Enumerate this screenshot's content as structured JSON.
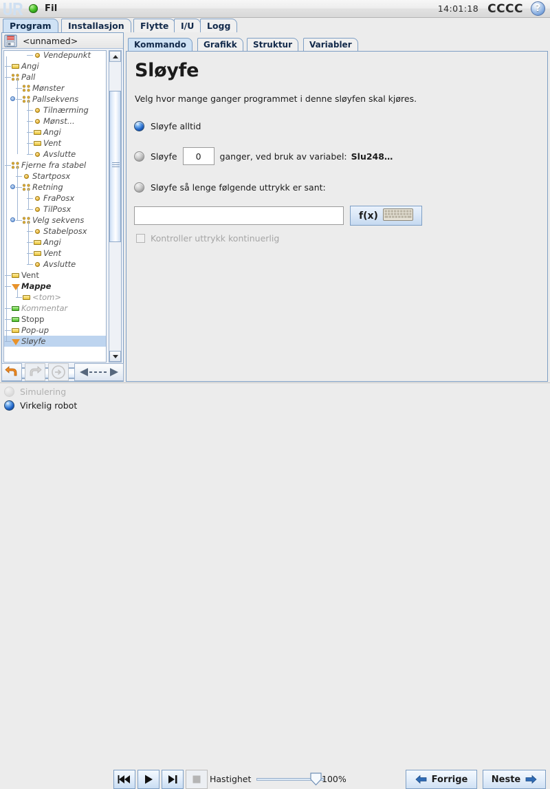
{
  "titlebar": {
    "file_menu_label": "Fil",
    "clock": "14:01:18",
    "robot_name": "CCCC",
    "help_label": "?"
  },
  "main_tabs": [
    {
      "label": "Program",
      "active": true
    },
    {
      "label": "Installasjon",
      "active": false
    },
    {
      "label": "Flytte",
      "active": false
    },
    {
      "label": "I/U",
      "active": false
    },
    {
      "label": "Logg",
      "active": false
    }
  ],
  "program_panel": {
    "program_name": "<unnamed>",
    "tree": [
      {
        "label": "Vendepunkt",
        "depth": 3,
        "icon": "dot",
        "style": "italic"
      },
      {
        "label": "Angi",
        "depth": 1,
        "icon": "rect",
        "style": "italic"
      },
      {
        "label": "Pall",
        "depth": 1,
        "icon": "pallet",
        "style": "italic",
        "knob": true
      },
      {
        "label": "Mønster",
        "depth": 2,
        "icon": "pallet",
        "style": "italic"
      },
      {
        "label": "Pallsekvens",
        "depth": 2,
        "icon": "pallet",
        "style": "italic",
        "knob": true
      },
      {
        "label": "Tilnærming",
        "depth": 3,
        "icon": "dot",
        "style": "italic"
      },
      {
        "label": "Mønst...",
        "depth": 3,
        "icon": "dot",
        "style": "italic"
      },
      {
        "label": "Angi",
        "depth": 3,
        "icon": "rect",
        "style": "italic"
      },
      {
        "label": "Vent",
        "depth": 3,
        "icon": "rect",
        "style": "italic"
      },
      {
        "label": "Avslutte",
        "depth": 3,
        "icon": "dot",
        "style": "italic"
      },
      {
        "label": "Fjerne fra stabel",
        "depth": 1,
        "icon": "pallet",
        "style": "italic",
        "knob": true
      },
      {
        "label": "Startposx",
        "depth": 2,
        "icon": "dot",
        "style": "italic"
      },
      {
        "label": "Retning",
        "depth": 2,
        "icon": "pallet",
        "style": "italic",
        "knob": true
      },
      {
        "label": "FraPosx",
        "depth": 3,
        "icon": "dot",
        "style": "italic"
      },
      {
        "label": "TilPosx",
        "depth": 3,
        "icon": "dot",
        "style": "italic"
      },
      {
        "label": "Velg sekvens",
        "depth": 2,
        "icon": "pallet",
        "style": "italic",
        "knob": true
      },
      {
        "label": "Stabelposx",
        "depth": 3,
        "icon": "dot",
        "style": "italic"
      },
      {
        "label": "Angi",
        "depth": 3,
        "icon": "rect",
        "style": "italic"
      },
      {
        "label": "Vent",
        "depth": 3,
        "icon": "rect",
        "style": "italic"
      },
      {
        "label": "Avslutte",
        "depth": 3,
        "icon": "dot",
        "style": "italic"
      },
      {
        "label": "Vent",
        "depth": 1,
        "icon": "rect",
        "style": "normal"
      },
      {
        "label": "Mappe",
        "depth": 1,
        "icon": "triangle",
        "style": "bold",
        "knob": true
      },
      {
        "label": "<tom>",
        "depth": 2,
        "icon": "rect",
        "style": "grey"
      },
      {
        "label": "Kommentar",
        "depth": 1,
        "icon": "rect-green",
        "style": "grey"
      },
      {
        "label": "Stopp",
        "depth": 1,
        "icon": "rect-green",
        "style": "normal"
      },
      {
        "label": "Pop-up",
        "depth": 1,
        "icon": "rect",
        "style": "italic"
      },
      {
        "label": "Sløyfe",
        "depth": 1,
        "icon": "triangle",
        "style": "italic",
        "knob": true,
        "selected": true
      }
    ],
    "toolbar": {
      "undo": "undo-arrow",
      "redo": "redo-arrow",
      "goto": "goto-arrow",
      "move": "move-handle"
    }
  },
  "sub_tabs": [
    {
      "label": "Kommando",
      "active": true
    },
    {
      "label": "Grafikk",
      "active": false
    },
    {
      "label": "Struktur",
      "active": false
    },
    {
      "label": "Variabler",
      "active": false
    }
  ],
  "command_panel": {
    "title": "Sløyfe",
    "description": "Velg hvor mange ganger programmet i denne sløyfen skal kjøres.",
    "options": [
      {
        "label": "Sløyfe alltid",
        "selected": true
      },
      {
        "label": "Sløyfe",
        "selected": false
      },
      {
        "label": "Sløyfe så lenge følgende uttrykk er sant:",
        "selected": false
      }
    ],
    "loop_count_value": "0",
    "loop_count_suffix": "ganger, ved bruk av variabel:",
    "loop_variable": "Slu248…",
    "expression_value": "",
    "expression_placeholder": "",
    "fx_button_label": "f(x)",
    "continuous_check_label": "Kontroller uttrykk kontinuerlig",
    "continuous_checked": false
  },
  "bottom_bar": {
    "simulation_label": "Simulering",
    "real_robot_label": "Virkelig robot",
    "real_robot_selected": true,
    "speed_label": "Hastighet",
    "speed_percent": "100%",
    "transport": [
      "rewind-icon",
      "play-icon",
      "step-forward-icon",
      "stop-icon"
    ],
    "prev_button": "Forrige",
    "next_button": "Neste"
  },
  "colors": {
    "tab_active": "#cfe2f5",
    "border_blue": "#7d9ec4",
    "accent_orange": "#e8922a",
    "panel_bg": "#ececec"
  }
}
